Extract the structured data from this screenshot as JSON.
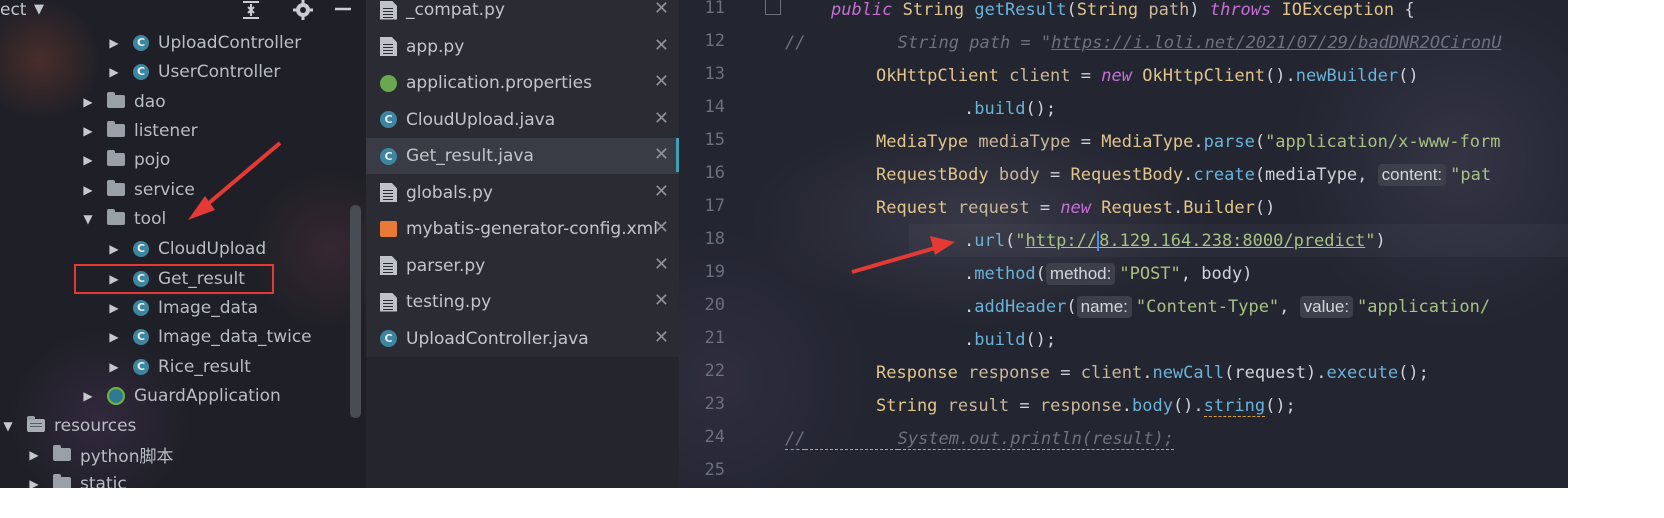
{
  "project": {
    "title": "ect",
    "chevron": "▼",
    "collapse_icon": "collapse-all-icon",
    "settings_icon": "gear-icon",
    "hide_icon": "minimize-icon",
    "tree": [
      {
        "label": "UploadController",
        "type": "class",
        "expanded": false
      },
      {
        "label": "UserController",
        "type": "class",
        "expanded": false
      },
      {
        "label": "dao",
        "type": "folder",
        "expanded": false
      },
      {
        "label": "listener",
        "type": "folder",
        "expanded": false
      },
      {
        "label": "pojo",
        "type": "folder",
        "expanded": false
      },
      {
        "label": "service",
        "type": "folder",
        "expanded": false
      },
      {
        "label": "tool",
        "type": "folder",
        "expanded": true
      },
      {
        "label": "CloudUpload",
        "type": "class",
        "expanded": false
      },
      {
        "label": "Get_result",
        "type": "class",
        "expanded": false,
        "highlighted": true
      },
      {
        "label": "Image_data",
        "type": "class",
        "expanded": false
      },
      {
        "label": "Image_data_twice",
        "type": "class",
        "expanded": false
      },
      {
        "label": "Rice_result",
        "type": "class",
        "expanded": false
      },
      {
        "label": "GuardApplication",
        "type": "app",
        "expanded": false
      },
      {
        "label": "resources",
        "type": "resources",
        "expanded": true
      },
      {
        "label": "python脚本",
        "type": "folder",
        "expanded": false
      },
      {
        "label": "static",
        "type": "folder",
        "expanded": false
      }
    ]
  },
  "tabs": {
    "close_glyph": "✕",
    "items": [
      {
        "label": "_compat.py",
        "icon": "file-icon"
      },
      {
        "label": "app.py",
        "icon": "file-icon"
      },
      {
        "label": "application.properties",
        "icon": "spring-icon"
      },
      {
        "label": "CloudUpload.java",
        "icon": "java-class-icon"
      },
      {
        "label": "Get_result.java",
        "icon": "java-class-icon",
        "active": true
      },
      {
        "label": "globals.py",
        "icon": "file-icon"
      },
      {
        "label": "mybatis-generator-config.xml",
        "icon": "xml-icon"
      },
      {
        "label": "parser.py",
        "icon": "file-icon"
      },
      {
        "label": "testing.py",
        "icon": "file-icon"
      },
      {
        "label": "UploadController.java",
        "icon": "java-class-icon"
      }
    ]
  },
  "editor": {
    "line_numbers": [
      "11",
      "12",
      "13",
      "14",
      "15",
      "16",
      "17",
      "18",
      "19",
      "20",
      "21",
      "22",
      "23",
      "24",
      "25"
    ],
    "lines": {
      "l11": {
        "kw1": "public",
        "type1": "String",
        "fn": "getResult",
        "p1": "(",
        "type2": "String",
        "var": "path",
        "p2": ")",
        "kw2": "throws",
        "type3": "IOException",
        "p3": "{"
      },
      "l12": {
        "prefix": "//",
        "text": "String path = \"",
        "url": "https://i.loli.net/2021/07/29/badDNR2OCironU"
      },
      "l13": {
        "type1": "OkHttpClient",
        "var": "client",
        "eq": "=",
        "kw": "new",
        "type2": "OkHttpClient",
        "p1": "().",
        "fn": "newBuilder",
        "p2": "()"
      },
      "l14": {
        "p1": ".",
        "fn": "build",
        "p2": "();"
      },
      "l15": {
        "type1": "MediaType",
        "var": "mediaType",
        "eq": "=",
        "type2": "MediaType",
        "p1": ".",
        "fn": "parse",
        "p2": "(",
        "str": "\"application/x-www-form"
      },
      "l16": {
        "type1": "RequestBody",
        "var": "body",
        "eq": "=",
        "type2": "RequestBody",
        "p1": ".",
        "fn": "create",
        "p2": "(mediaType,",
        "hint": "content:",
        "str": "\"pat"
      },
      "l17": {
        "type1": "Request",
        "var": "request",
        "eq": "=",
        "kw": "new",
        "type2": "Request",
        "p1": ".",
        "type3": "Builder",
        "p2": "()"
      },
      "l18": {
        "p1": ".",
        "fn": "url",
        "p2": "(",
        "q": "\"",
        "url1": "http://",
        "url2": "8.129.164.238:8000/predict",
        "q2": "\"",
        "p3": ")"
      },
      "l19": {
        "p1": ".",
        "fn": "method",
        "p2": "(",
        "hint": "method:",
        "str": "\"POST\"",
        "p3": ", body)"
      },
      "l20": {
        "p1": ".",
        "fn": "addHeader",
        "p2": "(",
        "hint1": "name:",
        "str1": "\"Content-Type\"",
        "comma": ",",
        "hint2": "value:",
        "str2": "\"application/"
      },
      "l21": {
        "p1": ".",
        "fn": "build",
        "p2": "();"
      },
      "l22": {
        "type1": "Response",
        "var": "response",
        "eq": "=",
        "v2": "client",
        "p1": ".",
        "fn1": "newCall",
        "p2": "(request).",
        "fn2": "execute",
        "p3": "();"
      },
      "l23": {
        "type1": "String",
        "var": "result",
        "eq": "=",
        "v2": "response",
        "p1": ".",
        "fn1": "body",
        "p2": "().",
        "fn2": "string",
        "p3": "();"
      },
      "l24": {
        "prefix": "//",
        "text": "System.out.println(result);"
      }
    }
  },
  "annotations": {
    "arrow_color": "#e53935",
    "highlight_box_color": "#e53935"
  }
}
